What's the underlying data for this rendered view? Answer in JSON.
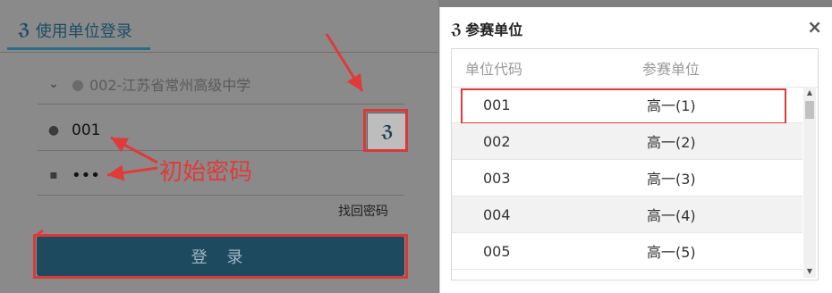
{
  "login": {
    "tab_label": "使用单位登录",
    "school_name": "002-江苏省常州高级中学",
    "username": "001",
    "password": "•••",
    "forgot_label": "找回密码",
    "login_button": "登 录"
  },
  "annotation": {
    "text": "初始密码",
    "color": "#e03a3a"
  },
  "dialog": {
    "title": "参赛单位",
    "close_glyph": "×",
    "columns": [
      "单位代码",
      "参赛单位"
    ],
    "rows": [
      {
        "code": "001",
        "name": "高一(1)"
      },
      {
        "code": "002",
        "name": "高一(2)"
      },
      {
        "code": "003",
        "name": "高一(3)"
      },
      {
        "code": "004",
        "name": "高一(4)"
      },
      {
        "code": "005",
        "name": "高一(5)"
      }
    ]
  },
  "icons": {
    "brand": "brand-logo-icon",
    "user": "user-icon",
    "lock": "lock-icon",
    "chevron": "chevron-down-icon",
    "school": "school-avatar-icon"
  },
  "colors": {
    "accent": "#1d4a5e",
    "highlight": "#e03a3a"
  }
}
